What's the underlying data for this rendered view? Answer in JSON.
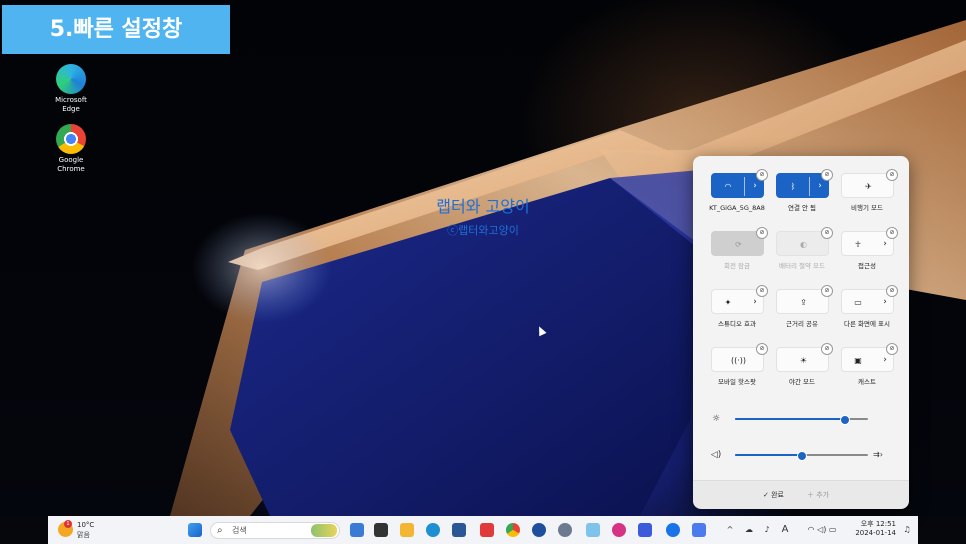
{
  "banner": {
    "title": "5.빠른 설정창"
  },
  "desktop": {
    "icons": [
      {
        "label_line1": "Microsoft",
        "label_line2": "Edge"
      },
      {
        "label_line1": "Google",
        "label_line2": "Chrome"
      }
    ],
    "watermark": {
      "title": "랩터와 고양이",
      "subtitle": "ⓒ랩터와고양이"
    }
  },
  "quick_settings": {
    "tiles": [
      {
        "label": "KT_GiGA_5G_8A8",
        "icon": "wifi-icon",
        "state": "on",
        "expand": true
      },
      {
        "label": "연결 안 됨",
        "icon": "bluetooth-icon",
        "state": "on",
        "expand": true
      },
      {
        "label": "비행기 모드",
        "icon": "airplane-icon",
        "state": "off",
        "expand": false
      },
      {
        "label": "회전 잠금",
        "icon": "rotation-lock-icon",
        "state": "disabled",
        "expand": false
      },
      {
        "label": "배터리 절약 모드",
        "icon": "battery-saver-icon",
        "state": "disabled-light",
        "expand": false
      },
      {
        "label": "접근성",
        "icon": "accessibility-icon",
        "state": "off",
        "expand": true
      },
      {
        "label": "스튜디오 효과",
        "icon": "studio-effects-icon",
        "state": "off",
        "expand": true
      },
      {
        "label": "근거리 공유",
        "icon": "nearby-share-icon",
        "state": "off",
        "expand": false
      },
      {
        "label": "다른 화면에 표시",
        "icon": "project-icon",
        "state": "off",
        "expand": true
      },
      {
        "label": "모바일 핫스팟",
        "icon": "hotspot-icon",
        "state": "off",
        "expand": false
      },
      {
        "label": "야간 모드",
        "icon": "night-light-icon",
        "state": "off",
        "expand": false
      },
      {
        "label": "캐스트",
        "icon": "cast-icon",
        "state": "off",
        "expand": true
      }
    ],
    "brightness": {
      "value": 0.83,
      "icon": "brightness-icon"
    },
    "volume": {
      "value": 0.5,
      "icon": "speaker-icon",
      "extra_icon": "audio-output-icon"
    },
    "footer": {
      "done_label": "완료",
      "add_label": "추가"
    }
  },
  "taskbar": {
    "weather": {
      "temp": "10°C",
      "condition": "맑음",
      "badge": "1"
    },
    "search": {
      "placeholder": "검색"
    },
    "clock": {
      "time": "오후 12:51",
      "date": "2024-01-14"
    },
    "tray_input": "A"
  },
  "colors": {
    "accent": "#1b63c4",
    "banner": "#4fb4ef",
    "watermark": "#1e6fd9"
  }
}
